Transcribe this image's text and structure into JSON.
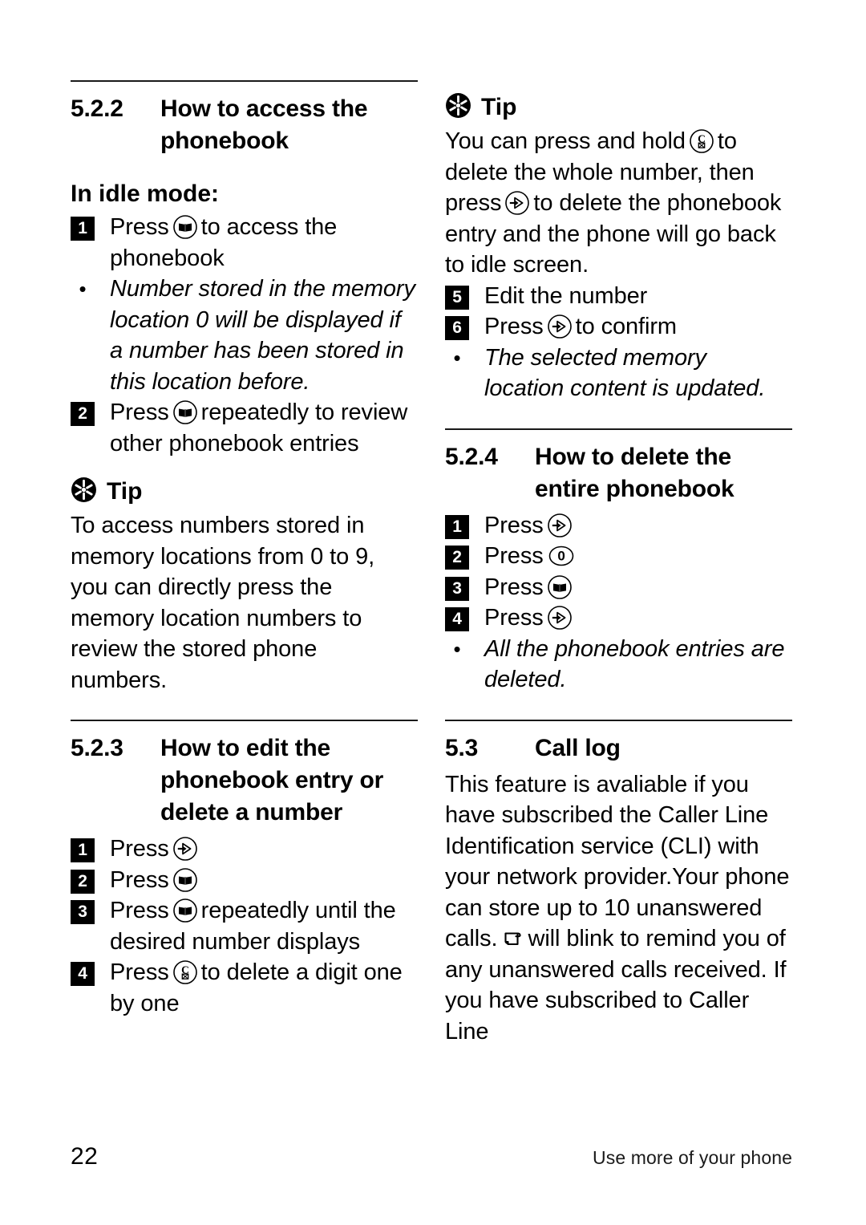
{
  "page": {
    "number": "22",
    "footer_note": "Use more of your phone"
  },
  "icons": {
    "phonebook": "phonebook-book-key-icon",
    "menu": "menu-ok-key-icon",
    "clear": "clear-delete-key-icon",
    "zero": "zero-key-icon",
    "tip": "tip-asterisk-icon",
    "missed_call": "missed-call-scroll-icon"
  },
  "left_column": {
    "section_522": {
      "number": "5.2.2",
      "title": "How to access the phonebook",
      "subheading": "In idle mode:",
      "steps": [
        {
          "num": "1",
          "before": "Press",
          "key": "phonebook",
          "after": "to access the phonebook"
        },
        {
          "num": "2",
          "before": "Press",
          "key": "phonebook",
          "after": "repeatedly to review other phonebook entries"
        }
      ],
      "note": "Number stored in the memory location 0 will be displayed if a number has been stored in this location before."
    },
    "tip": {
      "label": "Tip",
      "body": "To access numbers stored in memory locations from 0 to 9, you can directly press the memory location numbers to review the stored phone numbers."
    },
    "section_523": {
      "number": "5.2.3",
      "title": "How to edit the phonebook entry or delete a number",
      "steps": [
        {
          "num": "1",
          "before": "Press",
          "key": "menu",
          "after": ""
        },
        {
          "num": "2",
          "before": "Press",
          "key": "phonebook",
          "after": ""
        },
        {
          "num": "3",
          "before": "Press",
          "key": "phonebook",
          "after": "repeatedly until the desired number displays"
        },
        {
          "num": "4",
          "before": "Press",
          "key": "clear",
          "after": "to delete a digit one by one"
        }
      ]
    }
  },
  "right_column": {
    "tip": {
      "label": "Tip",
      "body_part1": "You can press and hold",
      "body_key1": "clear",
      "body_part2": "to delete the whole number, then press",
      "body_key2": "menu",
      "body_part3": "to delete the phonebook entry and the phone will go back to idle screen."
    },
    "continued_steps": [
      {
        "num": "5",
        "before": "Edit the number",
        "key": null,
        "after": ""
      },
      {
        "num": "6",
        "before": "Press",
        "key": "menu",
        "after": "to confirm"
      }
    ],
    "continued_note": "The selected memory location content is updated.",
    "section_524": {
      "number": "5.2.4",
      "title": "How to delete the entire phonebook",
      "steps": [
        {
          "num": "1",
          "before": "Press",
          "key": "menu",
          "after": ""
        },
        {
          "num": "2",
          "before": "Press",
          "key": "zero",
          "after": ""
        },
        {
          "num": "3",
          "before": "Press",
          "key": "phonebook",
          "after": ""
        },
        {
          "num": "4",
          "before": "Press",
          "key": "menu",
          "after": ""
        }
      ],
      "note": "All the phonebook entries are deleted."
    },
    "section_53": {
      "number": "5.3",
      "title": "Call log",
      "body_part1": "This feature is avaliable if you have subscribed the Caller Line Identification service (CLI) with your network provider.Your phone can store up to 10 unanswered calls.",
      "body_key": "missed_call",
      "body_part2": "will blink to remind you of any unanswered calls received. If you have subscribed to Caller Line"
    }
  }
}
